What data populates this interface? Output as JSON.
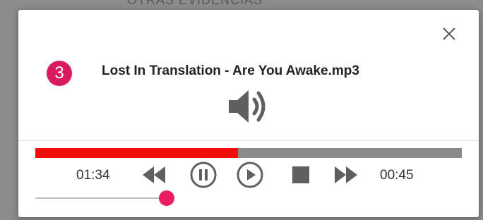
{
  "backdrop": {
    "text": "OTRAS EVIDENCIAS"
  },
  "player": {
    "badge": "3",
    "title": "Lost In Translation - Are You Awake.mp3",
    "time_elapsed": "01:34",
    "time_remaining": "00:45",
    "progress": 0.475,
    "volume": 1.0
  },
  "icons": {
    "close": "close-icon",
    "volume": "volume-icon",
    "rewind": "rewind-icon",
    "pause": "pause-icon",
    "play": "play-icon",
    "stop": "stop-icon",
    "fast_forward": "fast-forward-icon"
  },
  "colors": {
    "progress_fill": "#f20d0d",
    "progress_track": "#8a8a8a",
    "badge": "#d81b60",
    "slider_thumb": "#e91e63",
    "icon": "#5f5f5f"
  }
}
